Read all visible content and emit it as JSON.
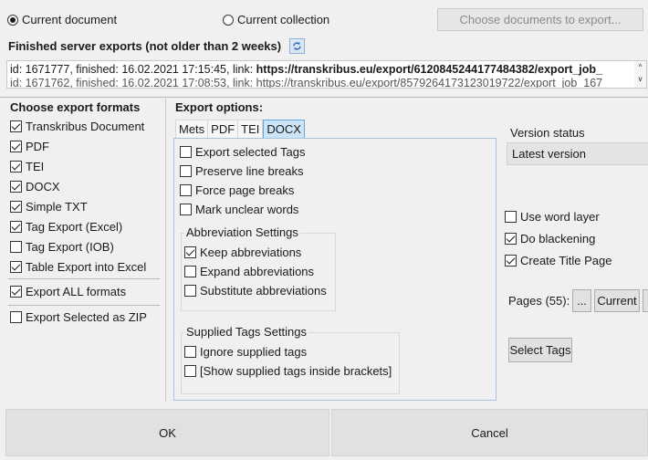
{
  "top": {
    "radio_current_document": "Current document",
    "radio_current_collection": "Current collection",
    "choose_documents_button": "Choose documents to export..."
  },
  "exports": {
    "heading": "Finished server exports (not older than 2 weeks)",
    "line1_prefix": "id: 1671777, finished: 16.02.2021 17:15:45, link: ",
    "line1_link": "https://transkribus.eu/export/6120845244177484382/export_job_",
    "line2": "id: 1671762, finished: 16.02.2021 17:08:53, link: https://transkribus.eu/export/8579264173123019722/export_job_167"
  },
  "formats": {
    "heading": "Choose export formats",
    "items": [
      {
        "label": "Transkribus Document",
        "checked": true
      },
      {
        "label": "PDF",
        "checked": true
      },
      {
        "label": "TEI",
        "checked": true
      },
      {
        "label": "DOCX",
        "checked": true
      },
      {
        "label": "Simple TXT",
        "checked": true
      },
      {
        "label": "Tag Export (Excel)",
        "checked": true
      },
      {
        "label": "Tag Export (IOB)",
        "checked": false
      },
      {
        "label": "Table Export into Excel",
        "checked": true
      }
    ],
    "export_all": "Export ALL formats",
    "export_zip": "Export Selected as ZIP"
  },
  "options": {
    "heading": "Export options:",
    "tabs": [
      "Mets",
      "PDF",
      "TEI",
      "DOCX"
    ],
    "active_tab": "DOCX",
    "export_selected_tags": "Export selected Tags",
    "preserve_line_breaks": "Preserve line breaks",
    "force_page_breaks": "Force page breaks",
    "mark_unclear_words": "Mark unclear words",
    "abbrev_heading": "Abbreviation Settings",
    "keep_abbreviations": "Keep abbreviations",
    "expand_abbreviations": "Expand abbreviations",
    "substitute_abbreviations": "Substitute abbreviations",
    "supplied_heading": "Supplied Tags Settings",
    "ignore_supplied_tags": "Ignore supplied tags",
    "show_supplied_tags": "[Show supplied tags inside brackets]"
  },
  "right": {
    "version_status_label": "Version status",
    "version_status_value": "Latest version",
    "use_word_layer": "Use word layer",
    "do_blackening": "Do blackening",
    "create_title_page": "Create Title Page",
    "pages_label": "Pages (55):",
    "pages_dots_button": "...",
    "pages_current_button": "Current",
    "select_tags_button": "Select Tags"
  },
  "footer": {
    "ok": "OK",
    "cancel": "Cancel"
  }
}
